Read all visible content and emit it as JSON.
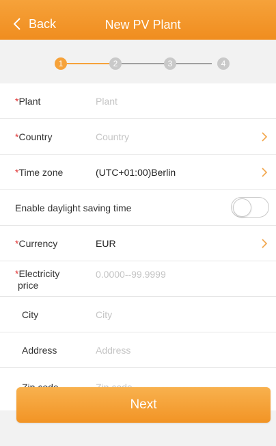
{
  "header": {
    "back_label": "Back",
    "title": "New PV Plant"
  },
  "stepper": {
    "steps": [
      "1",
      "2",
      "3",
      "4"
    ],
    "current": 1
  },
  "form": {
    "required_mark": "*",
    "fields": [
      {
        "label": "Plant",
        "required": true,
        "placeholder": "Plant",
        "value": ""
      },
      {
        "label": "Country",
        "required": true,
        "placeholder": "Country",
        "value": "",
        "chevron": true
      },
      {
        "label": "Time zone",
        "required": true,
        "placeholder": "",
        "value": "(UTC+01:00)Berlin",
        "chevron": true
      },
      {
        "label": "Enable daylight saving time",
        "toggle": false
      },
      {
        "label": "Currency",
        "required": true,
        "placeholder": "",
        "value": "EUR",
        "chevron": true
      },
      {
        "label_line1": "Electricity",
        "label_line2": "price",
        "required": true,
        "placeholder": "0.0000--99.9999",
        "value": ""
      },
      {
        "label": "City",
        "required": false,
        "placeholder": "City",
        "value": ""
      },
      {
        "label": "Address",
        "required": false,
        "placeholder": "Address",
        "value": ""
      },
      {
        "label": "Zip code",
        "required": false,
        "placeholder": "Zip code",
        "value": ""
      }
    ]
  },
  "footer": {
    "next_label": "Next"
  },
  "colors": {
    "accent": "#f29425",
    "required": "#e03131"
  },
  "icons": {
    "back": "chevron-left-icon",
    "chevron": "chevron-right-icon"
  }
}
